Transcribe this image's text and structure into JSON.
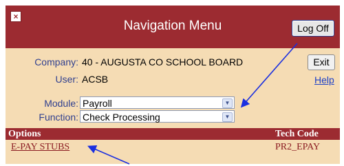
{
  "title_bar": {
    "title": "Navigation Menu",
    "close_glyph": "×",
    "logoff_label": "Log Off"
  },
  "info": {
    "company_label": "Company:",
    "company_value": "40 - AUGUSTA CO SCHOOL BOARD",
    "user_label": "User:",
    "user_value": "ACSB",
    "exit_label": "Exit",
    "help_label": "Help"
  },
  "form": {
    "module_label": "Module:",
    "module_value": "Payroll",
    "function_label": "Function:",
    "function_value": "Check Processing"
  },
  "options_table": {
    "headers": [
      "Options",
      "Tech Code"
    ],
    "rows": [
      {
        "option": "E-PAY STUBS",
        "tech_code": "PR2_EPAY"
      }
    ]
  },
  "colors": {
    "accent": "#9c2b31",
    "panel": "#f5dcb4",
    "label_text": "#2f3f8f",
    "link": "#1b3fc7",
    "arrow": "#1a2fe0"
  },
  "icons": {
    "close": "close-icon",
    "select_chevron": "chevron-down-icon"
  }
}
